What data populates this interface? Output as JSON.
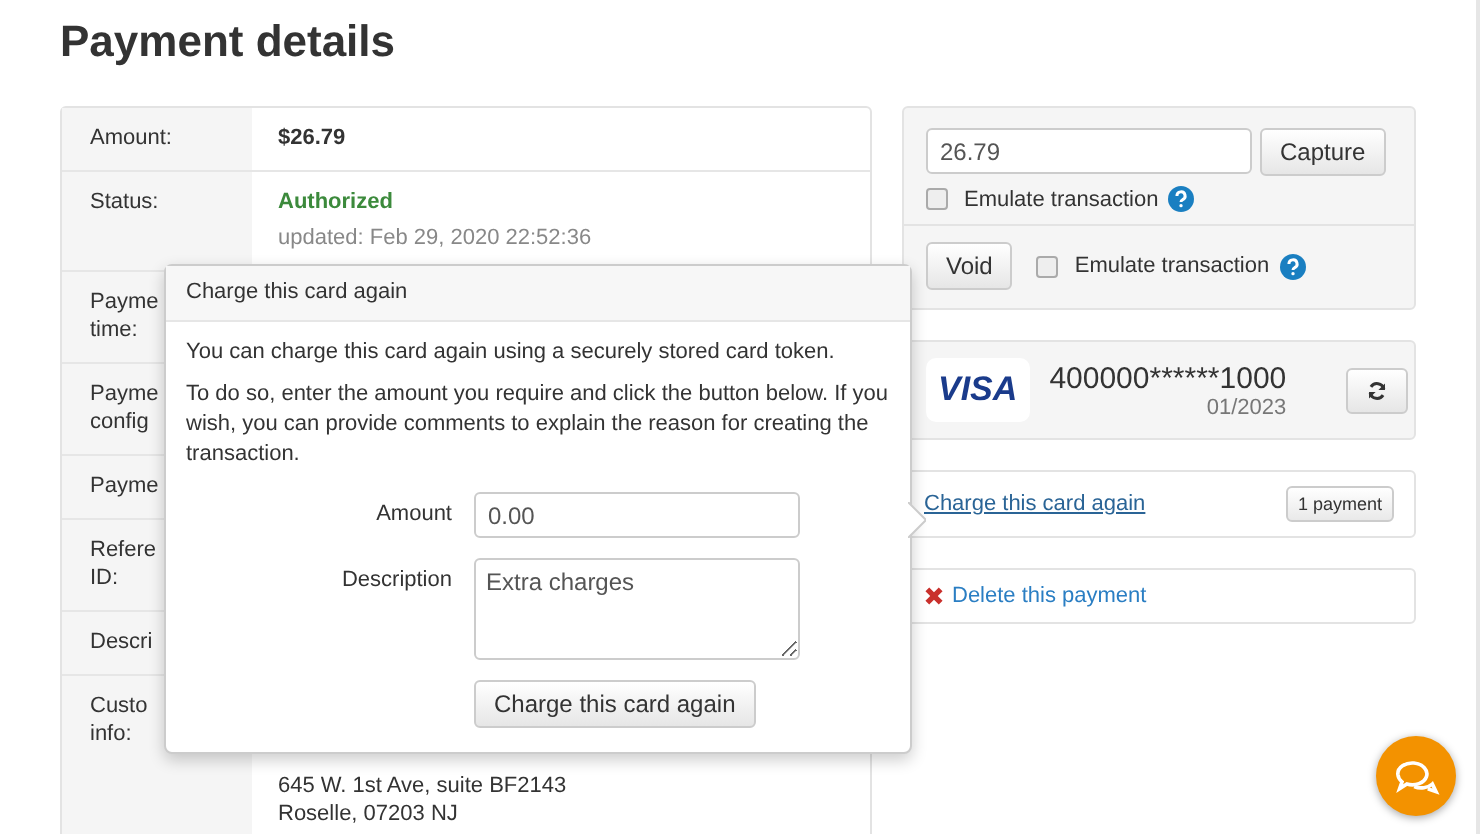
{
  "title": "Payment details",
  "details": [
    {
      "label": [
        "Amount:"
      ],
      "lines": [
        {
          "kind": "strong",
          "text": "$26.79"
        }
      ]
    },
    {
      "label": [
        "Status:"
      ],
      "lines": [
        {
          "kind": "status",
          "text": "Authorized"
        },
        {
          "kind": "note",
          "text": "updated: Feb 29, 2020 22:52:36"
        }
      ]
    },
    {
      "label": [
        "Payme",
        "time:"
      ]
    },
    {
      "label": [
        "Payme",
        "config"
      ]
    },
    {
      "label": [
        "Payme"
      ]
    },
    {
      "label": [
        "Refere",
        "ID:"
      ]
    },
    {
      "label": [
        "Descri"
      ]
    },
    {
      "label": [
        "Custo",
        "info:"
      ],
      "lines": [
        {
          "kind": "plain",
          "text": "645 W. 1st Ave, suite BF2143"
        },
        {
          "kind": "plain",
          "text": "Roselle, 07203 NJ"
        }
      ]
    }
  ],
  "capture": {
    "value": "26.79",
    "button": "Capture",
    "emulate": {
      "label": "Emulate transaction",
      "checked": false
    }
  },
  "void": {
    "button": "Void",
    "emulate": {
      "label": "Emulate transaction",
      "checked": false
    }
  },
  "card": {
    "brand": "VISA",
    "number": "400000******1000",
    "expiry": "01/2023"
  },
  "charge_again": {
    "link": "Charge this card again",
    "badge": "1 payment"
  },
  "delete": {
    "link": "Delete this payment"
  },
  "popover": {
    "title": "Charge this card again",
    "paragraphs": [
      "You can charge this card again using a securely stored card token.",
      "To do so, enter the amount you require and click the button below. If you wish, you can provide comments to explain the reason for creating the transaction."
    ],
    "amount": {
      "label": "Amount",
      "value": "0.00"
    },
    "description": {
      "label": "Description",
      "value": "Extra charges"
    },
    "button": "Charge this card again"
  }
}
